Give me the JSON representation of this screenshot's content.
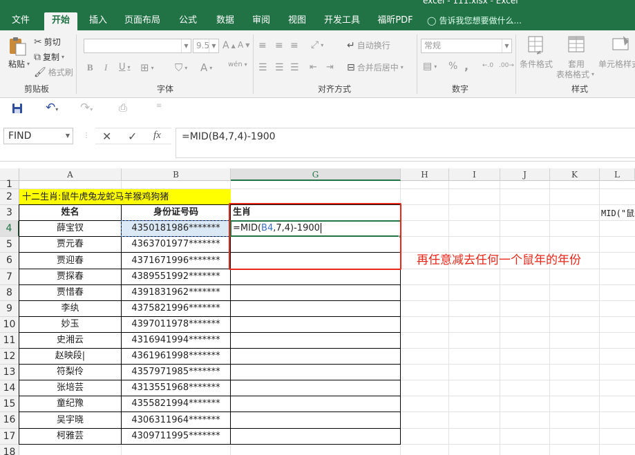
{
  "window": {
    "title": "excel - 111.xlsx - Excel"
  },
  "ribbon_tabs": [
    "文件",
    "开始",
    "插入",
    "页面布局",
    "公式",
    "数据",
    "审阅",
    "视图",
    "开发工具",
    "福昕PDF"
  ],
  "tell_me": "告诉我您想要做什么...",
  "clipboard": {
    "paste": "粘贴",
    "cut": "剪切",
    "copy": "复制",
    "format_painter": "格式刷",
    "group": "剪贴板"
  },
  "font": {
    "name_value": "",
    "size_value": "9.5",
    "group": "字体",
    "bold": "B",
    "italic": "I",
    "underline": "U",
    "wen": "wén"
  },
  "alignment": {
    "wrap": "自动换行",
    "merge": "合并后居中",
    "group": "对齐方式"
  },
  "number": {
    "format_value": "常规",
    "group": "数字",
    "percent": "%",
    "comma": ","
  },
  "styles": {
    "conditional": "条件格式",
    "table_line1": "套用",
    "table_line2": "表格格式",
    "cell_styles": "单元格样式",
    "group": "样式"
  },
  "formula_bar": {
    "name_box": "FIND",
    "fx": "fx",
    "formula": "=MID(B4,7,4)-1900"
  },
  "columns": [
    "A",
    "B",
    "G",
    "H",
    "I",
    "J",
    "K",
    "L"
  ],
  "rows": [
    "1",
    "2",
    "3",
    "4",
    "5",
    "6",
    "7",
    "8",
    "9",
    "10",
    "11",
    "12",
    "13",
    "14",
    "15",
    "16",
    "17",
    "18"
  ],
  "sheet": {
    "banner": "十二生肖:鼠牛虎兔龙蛇马羊猴鸡狗猪",
    "headers": [
      "姓名",
      "身份证号码",
      "生肖"
    ],
    "edit_prefix": "=MID(",
    "edit_ref": "B4",
    "edit_suffix": ",7,4)-1900",
    "records": [
      {
        "name": "薛宝钗",
        "id": "4350181986*******"
      },
      {
        "name": "贾元春",
        "id": "4363701977*******"
      },
      {
        "name": "贾迎春",
        "id": "4371671996*******"
      },
      {
        "name": "贾探春",
        "id": "4389551992*******"
      },
      {
        "name": "贾惜春",
        "id": "4391831962*******"
      },
      {
        "name": "李纨",
        "id": "4375821996*******"
      },
      {
        "name": "妙玉",
        "id": "4397011978*******"
      },
      {
        "name": "史湘云",
        "id": "4316941994*******"
      },
      {
        "name": "赵映段|",
        "id": "4361961998*******"
      },
      {
        "name": "符梨伶",
        "id": "4357971985*******"
      },
      {
        "name": "张培芸",
        "id": "4313551968*******"
      },
      {
        "name": "童纪豫",
        "id": "4355821994*******"
      },
      {
        "name": "吴宇晓",
        "id": "4306311964*******"
      },
      {
        "name": "柯雅芸",
        "id": "4309711995*******"
      }
    ],
    "cut_off_text": "MID(\"鼠",
    "annotation": "再任意减去任何一个鼠年的年份"
  },
  "colors": {
    "accent": "#217346",
    "banner_fill": "#ffff00",
    "annotation": "#e8261a",
    "ref_blue": "#3b6fc4"
  }
}
